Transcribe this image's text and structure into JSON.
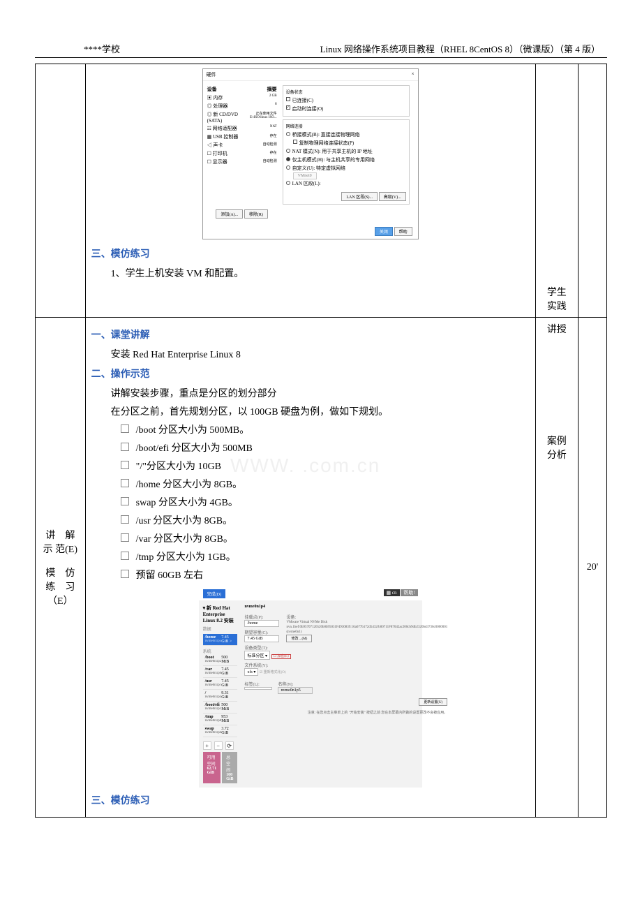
{
  "header": {
    "left": "****学校",
    "right": "Linux 网络操作系统项目教程（RHEL 8CentOS 8）（微课版）（第 4 版）"
  },
  "watermark": "WWW.  .com.cn",
  "row1": {
    "section3_title": "三、模仿练习",
    "item1": "1、学生上机安装 VM 和配置。",
    "activity_line1": "学生",
    "activity_line2": "实践"
  },
  "vm_dialog": {
    "title": "硬件",
    "close": "×",
    "col_device": "设备",
    "col_summary": "摘要",
    "rows": [
      {
        "name": "▣ 内存",
        "val": "2 GB"
      },
      {
        "name": "◎ 处理器",
        "val": "8"
      },
      {
        "name": "◎ 新 CD/DVD (SATA)",
        "val": "正在使用文件 E:\\ISO\\linux ISO..."
      },
      {
        "name": "☷ 网络适配器",
        "val": "NAT"
      },
      {
        "name": "▦ USB 控制器",
        "val": "存在"
      },
      {
        "name": "◁ 声卡",
        "val": "自动检测"
      },
      {
        "name": "☐ 打印机",
        "val": "存在"
      },
      {
        "name": "☐ 显示器",
        "val": "自动检测"
      }
    ],
    "status_title": "设备状态",
    "status_connected": "已连接(C)",
    "status_on_power": "启动时连接(O)",
    "net_title": "网络连接",
    "net_bridged": "桥接模式(B): 直接连接物理网络",
    "net_replicate": "复制物理网络连接状态(P)",
    "net_nat": "NAT 模式(N): 用于共享主机的 IP 地址",
    "net_host": "仅主机模式(H): 与主机共享的专用网络",
    "net_custom": "自定义(U): 特定虚拟网络",
    "net_vmnet0": "VMnet0",
    "net_lan": "LAN 区段(L):",
    "btn_lan": "LAN 区段(S)...",
    "btn_adv": "高级(V)...",
    "btn_add": "添加(A)...",
    "btn_remove": "移除(R)",
    "btn_close": "关闭",
    "btn_help": "帮助"
  },
  "row2": {
    "left_line1": "讲　解",
    "left_line2": "示 范(E)",
    "left_line3": "模　仿",
    "left_line4": "练　习",
    "left_line5": "（E）",
    "sec1_title": "一、课堂讲解",
    "sec1_text": "安装 Red Hat Enterprise Linux 8",
    "sec2_title": "二、操作示范",
    "sec2_text1": "讲解安装步骤，重点是分区的划分部分",
    "sec2_text2": "在分区之前，首先规划分区，以 100GB 硬盘为例，做如下规划。",
    "bullets": [
      "/boot 分区大小为 500MB。",
      "/boot/efi 分区大小为 500MB",
      "\"/\"分区大小为 10GB",
      "/home 分区大小为 8GB。",
      "swap 分区大小为 4GB。",
      "/usr 分区大小为 8GB。",
      "/var 分区大小为 8GB。",
      "/tmp 分区大小为 1GB。",
      "预留 60GB 左右"
    ],
    "sec3_title": "三、模仿练习",
    "activity1": "讲授",
    "activity2_l1": "案例",
    "activity2_l2": "分析",
    "time": "20'"
  },
  "installer": {
    "done": "完成(D)",
    "top_right_lang": "▦ cn",
    "top_right_help": "帮助!",
    "section_title": "▾ 新 Red Hat Enterprise Linux 8.2 安装",
    "section_sub": "数据",
    "mounts": [
      {
        "name": "/home",
        "dev": "nvme0n1p5",
        "size": "7.45 GiB",
        "selected": true,
        "badge": ">"
      },
      {
        "name": "系统",
        "dev": "",
        "size": "",
        "selected": false,
        "isHeader": true
      },
      {
        "name": "/boot",
        "dev": "nvme0n1p2",
        "size": "500 MiB"
      },
      {
        "name": "/var",
        "dev": "nvme0n1p9",
        "size": "7.45 GiB"
      },
      {
        "name": "/usr",
        "dev": "nvme0n1p7",
        "size": "7.45 GiB"
      },
      {
        "name": "/",
        "dev": "nvme0n1p3",
        "size": "9.31 GiB"
      },
      {
        "name": "/boot/efi",
        "dev": "nvme0n1p1",
        "size": "500 MiB"
      },
      {
        "name": "/tmp",
        "dev": "nvme0n1p8",
        "size": "953 MiB"
      },
      {
        "name": "swap",
        "dev": "nvme0n1p4",
        "size": "3.72 GiB"
      }
    ],
    "right_title": "nvme0n1p4",
    "mount_point_label": "挂载点(P):",
    "mount_point_val": "/home",
    "capacity_label": "期望容量(C):",
    "capacity_val": "7.45 GiB",
    "device_label": "设备:",
    "device_text": "VMware Virtual NVMe Disk nvn.1bef:0b95707126520b0b95031F4930839:16a677b172d5432/b00711F87042ac200cb9db2320bd3736c0000001 (nvme0n1)",
    "modify_btn": "修改 ...(M)",
    "devtype_label": "设备类型(T):",
    "devtype_val": "标准分区",
    "encrypt": "加密(E)",
    "fs_label": "文件系统(Y):",
    "fs_val": "xfs",
    "reformat": "重新格式化(O)",
    "label_label": "标签(L):",
    "name_label": "名称(N):",
    "name_val": "nvme0n1p5",
    "update_btn": "更新设置(U)",
    "note": "注意: 在您点击主菜单上的 \"开始安装\" 按钮之前\n您在本屏幕内所做的设置更改不会被应用。",
    "avail_label": "可用空间",
    "avail_val": "62.71 GiB",
    "total_label": "总空间",
    "total_val": "100 GiB"
  }
}
